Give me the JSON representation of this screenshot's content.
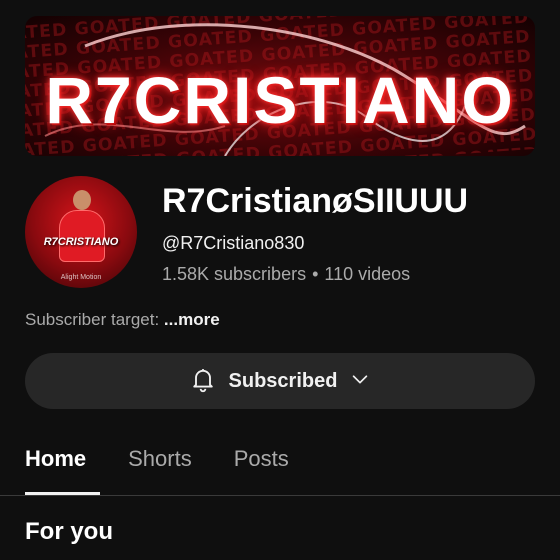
{
  "banner": {
    "title": "R7CRISTIANO",
    "pattern_text": "GOATED GOATED GOATED GOATED GOATED GOATED GOATED GOATED"
  },
  "avatar": {
    "title": "R7CRISTIANO",
    "watermark": "Alight Motion"
  },
  "channel": {
    "name": "R7CristianøSIIUUU",
    "handle": "@R7Cristiano830",
    "subscribers": "1.58K subscribers",
    "separator": "•",
    "videos": "110 videos"
  },
  "description": {
    "text": "Subscriber target: ",
    "more": "...more"
  },
  "subscribe": {
    "label": "Subscribed",
    "icon": "bell-icon",
    "chevron": "chevron-down-icon"
  },
  "tabs": [
    {
      "label": "Home",
      "active": true
    },
    {
      "label": "Shorts",
      "active": false
    },
    {
      "label": "Posts",
      "active": false
    }
  ],
  "section": {
    "title": "For you"
  },
  "colors": {
    "background": "#0f0f0f",
    "button": "#272727",
    "text_primary": "#f1f1f1",
    "text_secondary": "#aaaaaa",
    "banner_red": "#d4141a"
  }
}
